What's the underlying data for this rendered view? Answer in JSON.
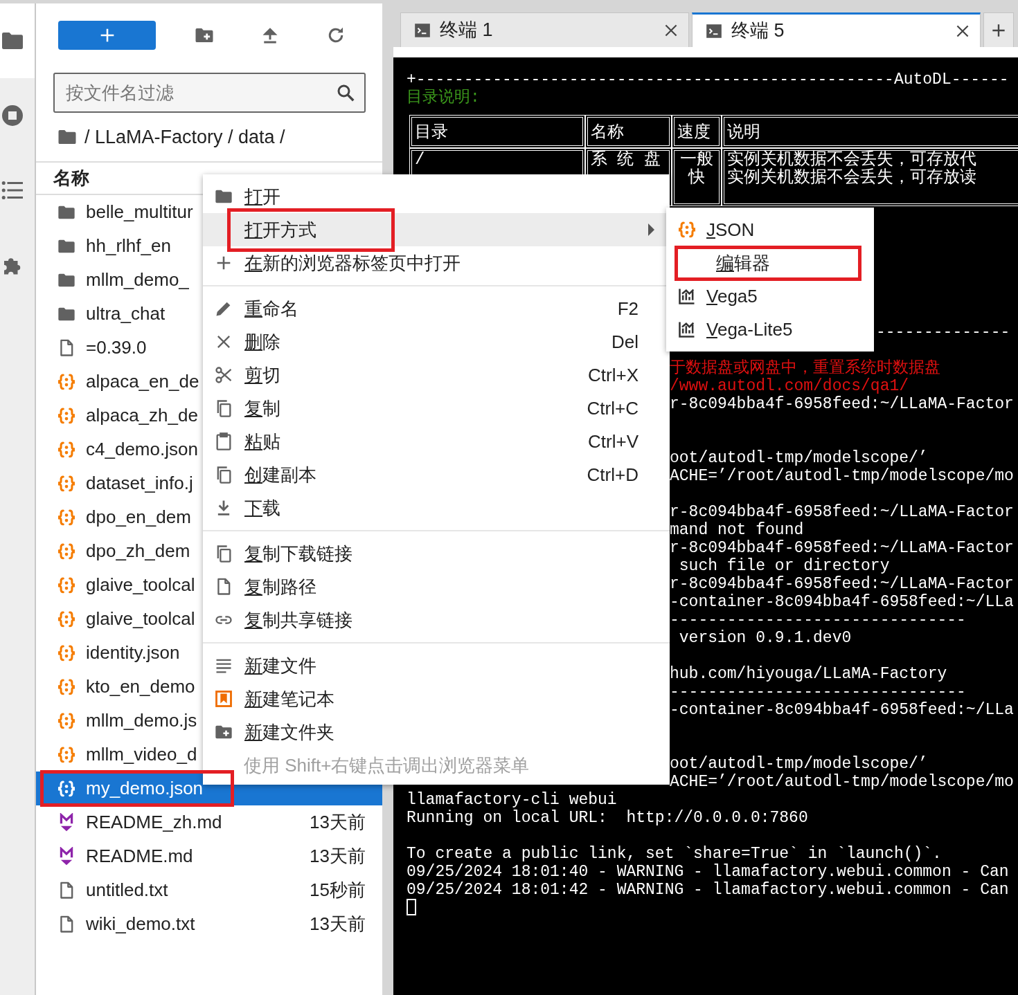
{
  "sidebar": [
    {
      "kind": "files",
      "selected": true
    },
    {
      "kind": "running",
      "selected": false
    },
    {
      "kind": "toc",
      "selected": false
    },
    {
      "kind": "extensions",
      "selected": false
    }
  ],
  "file_browser": {
    "filter": {
      "placeholder": "按文件名过滤"
    },
    "breadcrumb": "/ LLaMA-Factory / data /",
    "column": "名称",
    "files": [
      {
        "name": "belle_multitur",
        "kind": "folder",
        "selected": false
      },
      {
        "name": "hh_rlhf_en",
        "kind": "folder",
        "selected": false
      },
      {
        "name": "mllm_demo_",
        "kind": "folder",
        "selected": false
      },
      {
        "name": "ultra_chat",
        "kind": "folder",
        "selected": false
      },
      {
        "name": "=0.39.0",
        "kind": "file",
        "selected": false
      },
      {
        "name": "alpaca_en_de",
        "kind": "json",
        "selected": false
      },
      {
        "name": "alpaca_zh_de",
        "kind": "json",
        "selected": false
      },
      {
        "name": "c4_demo.json",
        "kind": "json",
        "selected": false
      },
      {
        "name": "dataset_info.j",
        "kind": "json",
        "selected": false
      },
      {
        "name": "dpo_en_dem",
        "kind": "json",
        "selected": false
      },
      {
        "name": "dpo_zh_dem",
        "kind": "json",
        "selected": false
      },
      {
        "name": "glaive_toolcal",
        "kind": "json",
        "selected": false
      },
      {
        "name": "glaive_toolcal",
        "kind": "json",
        "selected": false
      },
      {
        "name": "identity.json",
        "kind": "json",
        "selected": false
      },
      {
        "name": "kto_en_demo",
        "kind": "json",
        "selected": false
      },
      {
        "name": "mllm_demo.js",
        "kind": "json",
        "selected": false
      },
      {
        "name": "mllm_video_d",
        "kind": "json",
        "selected": false
      },
      {
        "name": "my_demo.json",
        "kind": "json",
        "selected": true,
        "marked": true
      },
      {
        "name": "README_zh.md",
        "kind": "markdown",
        "selected": false,
        "modified": "13天前"
      },
      {
        "name": "README.md",
        "kind": "markdown",
        "selected": false,
        "modified": "13天前"
      },
      {
        "name": "untitled.txt",
        "kind": "file",
        "selected": false,
        "modified": "15秒前"
      },
      {
        "name": "wiki_demo.txt",
        "kind": "file",
        "selected": false,
        "modified": "13天前"
      }
    ]
  },
  "context_menu": {
    "items": [
      {
        "kind": "open",
        "label": "打开"
      },
      {
        "kind": "open-with",
        "label": "打开方式",
        "hover": true,
        "submenu": true,
        "marked": true
      },
      {
        "kind": "new-tab",
        "label": "在新的浏览器标签页中打开"
      },
      {
        "kind": "divider"
      },
      {
        "kind": "rename",
        "label": "重命名",
        "shortcut": "F2"
      },
      {
        "kind": "delete",
        "label": "删除",
        "shortcut": "Del"
      },
      {
        "kind": "cut",
        "label": "剪切",
        "shortcut": "Ctrl+X"
      },
      {
        "kind": "copy",
        "label": "复制",
        "shortcut": "Ctrl+C"
      },
      {
        "kind": "paste",
        "label": "粘贴",
        "shortcut": "Ctrl+V"
      },
      {
        "kind": "duplicate",
        "label": "创建副本",
        "shortcut": "Ctrl+D"
      },
      {
        "kind": "download",
        "label": "下载"
      },
      {
        "kind": "divider"
      },
      {
        "kind": "copy-download-link",
        "label": "复制下载链接"
      },
      {
        "kind": "copy-path",
        "label": "复制路径"
      },
      {
        "kind": "share-link",
        "label": "复制共享链接"
      },
      {
        "kind": "divider"
      },
      {
        "kind": "new-file",
        "label": "新建文件"
      },
      {
        "kind": "new-notebook",
        "label": "新建笔记本"
      },
      {
        "kind": "new-folder",
        "label": "新建文件夹"
      },
      {
        "kind": "hint",
        "label": "使用 Shift+右键点击调出浏览器菜单"
      }
    ]
  },
  "submenu": {
    "items": [
      {
        "kind": "json",
        "label": "JSON"
      },
      {
        "kind": "editor",
        "label": "编辑器",
        "marked": true
      },
      {
        "kind": "vega",
        "label": "Vega5"
      },
      {
        "kind": "vega",
        "label": "Vega-Lite5"
      }
    ]
  },
  "terminal": {
    "tabs": [
      {
        "label": "终端 1",
        "selected": false
      },
      {
        "label": "终端 5",
        "selected": true
      }
    ],
    "head": [
      {
        "text": "+--------------------------------------------------AutoDL------"
      },
      {
        "text": "目录说明:",
        "color": "#3c9a1c"
      }
    ],
    "table": {
      "columns": [
        "目录",
        "名称",
        "速度",
        "说明"
      ],
      "row": [
        [
          "/"
        ],
        [
          "系 统 盘"
        ],
        [
          "一般",
          "快"
        ],
        [
          "实例关机数据不会丢失，可存放代",
          "实例关机数据不会丢失，可存放读"
        ]
      ]
    },
    "lines": [
      {
        "kind": "blank"
      },
      {
        "kind": "blank"
      },
      {
        "kind": "blank"
      },
      {
        "kind": "blank"
      },
      {
        "kind": "blank"
      },
      {
        "kind": "blank"
      },
      {
        "kind": "tail",
        "text": "--------------"
      },
      {
        "kind": "blank"
      },
      {
        "kind": "partial",
        "text": "于数据盘或网盘中，重置系统时数据盘",
        "color": "#e01010"
      },
      {
        "kind": "partial",
        "text": "/www.autodl.com/docs/qa1/",
        "color": "#e01010"
      },
      {
        "kind": "partial",
        "text": "r-8c094bba4f-6958feed:~/LLaMA-Factor"
      },
      {
        "kind": "blank"
      },
      {
        "kind": "blank"
      },
      {
        "kind": "partial",
        "text": "oot/autodl-tmp/modelscope/’"
      },
      {
        "kind": "partial",
        "text": "ACHE=’/root/autodl-tmp/modelscope/mo"
      },
      {
        "kind": "blank"
      },
      {
        "kind": "partial",
        "text": "r-8c094bba4f-6958feed:~/LLaMA-Factor"
      },
      {
        "kind": "partial",
        "text": "mand not found"
      },
      {
        "kind": "partial",
        "text": "r-8c094bba4f-6958feed:~/LLaMA-Factor"
      },
      {
        "kind": "partial",
        "text": " such file or directory"
      },
      {
        "kind": "partial",
        "text": "r-8c094bba4f-6958feed:~/LLaMA-Factor"
      },
      {
        "kind": "partial",
        "text": "-container-8c094bba4f-6958feed:~/LLa"
      },
      {
        "kind": "partial",
        "text": "-------------------------------"
      },
      {
        "kind": "partial",
        "text": " version 0.9.1.dev0"
      },
      {
        "kind": "blank"
      },
      {
        "kind": "partial",
        "text": "hub.com/hiyouga/LLaMA-Factory"
      },
      {
        "kind": "partial",
        "text": "-------------------------------"
      },
      {
        "kind": "partial",
        "text": "-container-8c094bba4f-6958feed:~/LLa"
      },
      {
        "kind": "blank"
      },
      {
        "kind": "blank"
      },
      {
        "kind": "partial",
        "text": "oot/autodl-tmp/modelscope/’"
      },
      {
        "kind": "partial",
        "text": "ACHE=’/root/autodl-tmp/modelscope/mo"
      },
      {
        "kind": "full",
        "text": "llamafactory-cli webui"
      },
      {
        "kind": "full",
        "text": "Running on local URL:  http://0.0.0.0:7860"
      },
      {
        "kind": "blank"
      },
      {
        "kind": "full",
        "text": "To create a public link, set `share=True` in `launch()`."
      },
      {
        "kind": "full",
        "text": "09/25/2024 18:01:40 - WARNING - llamafactory.webui.common - Can"
      },
      {
        "kind": "full",
        "text": "09/25/2024 18:01:42 - WARNING - llamafactory.webui.common - Can"
      },
      {
        "kind": "cursor"
      }
    ]
  }
}
